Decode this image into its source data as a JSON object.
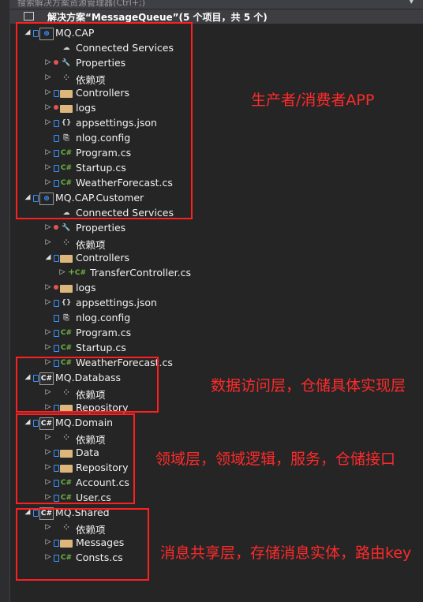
{
  "search": {
    "placeholder": "搜索解决方案资源管理器(Ctrl+;)"
  },
  "solution": {
    "label": "解决方案“MessageQueue”(5 个项目，共 5 个)"
  },
  "tree": [
    {
      "label": "MQ.CAP",
      "icon": "project-icon",
      "arrow": "expanded",
      "lock": true,
      "indent": 0
    },
    {
      "label": "Connected Services",
      "icon": "cloud-icon",
      "arrow": "none",
      "lock": false,
      "indent": 1
    },
    {
      "label": "Properties",
      "icon": "properties-icon",
      "arrow": "collapsed",
      "lock": false,
      "red": true,
      "indent": 1
    },
    {
      "label": "依赖项",
      "icon": "dependencies-icon",
      "arrow": "collapsed",
      "lock": false,
      "indent": 1
    },
    {
      "label": "Controllers",
      "icon": "folder-icon",
      "arrow": "collapsed",
      "lock": true,
      "indent": 1
    },
    {
      "label": "logs",
      "icon": "folder-icon",
      "arrow": "collapsed",
      "lock": false,
      "red": true,
      "indent": 1
    },
    {
      "label": "appsettings.json",
      "icon": "json-icon",
      "arrow": "collapsed",
      "lock": true,
      "indent": 1
    },
    {
      "label": "nlog.config",
      "icon": "config-icon",
      "arrow": "none",
      "lock": true,
      "indent": 1
    },
    {
      "label": "Program.cs",
      "icon": "csharp-icon",
      "arrow": "collapsed",
      "lock": true,
      "indent": 1
    },
    {
      "label": "Startup.cs",
      "icon": "csharp-icon",
      "arrow": "collapsed",
      "lock": true,
      "indent": 1
    },
    {
      "label": "WeatherForecast.cs",
      "icon": "csharp-icon",
      "arrow": "collapsed",
      "lock": true,
      "indent": 1
    },
    {
      "label": "MQ.CAP.Customer",
      "icon": "project-icon",
      "arrow": "expanded",
      "lock": true,
      "indent": 0
    },
    {
      "label": "Connected Services",
      "icon": "cloud-icon",
      "arrow": "none",
      "lock": false,
      "indent": 1
    },
    {
      "label": "Properties",
      "icon": "properties-icon",
      "arrow": "collapsed",
      "lock": false,
      "red": true,
      "indent": 1
    },
    {
      "label": "依赖项",
      "icon": "dependencies-icon",
      "arrow": "collapsed",
      "lock": false,
      "indent": 1
    },
    {
      "label": "Controllers",
      "icon": "folder-icon",
      "arrow": "expanded",
      "lock": true,
      "indent": 1
    },
    {
      "label": "TransferController.cs",
      "icon": "csharp-icon",
      "arrow": "collapsed",
      "lock": false,
      "plus": true,
      "indent": 2
    },
    {
      "label": "logs",
      "icon": "folder-icon",
      "arrow": "collapsed",
      "lock": false,
      "red": true,
      "indent": 1
    },
    {
      "label": "appsettings.json",
      "icon": "json-icon",
      "arrow": "collapsed",
      "lock": true,
      "indent": 1
    },
    {
      "label": "nlog.config",
      "icon": "config-icon",
      "arrow": "none",
      "lock": true,
      "indent": 1
    },
    {
      "label": "Program.cs",
      "icon": "csharp-icon",
      "arrow": "collapsed",
      "lock": true,
      "indent": 1
    },
    {
      "label": "Startup.cs",
      "icon": "csharp-icon",
      "arrow": "collapsed",
      "lock": true,
      "indent": 1
    },
    {
      "label": "WeatherForecast.cs",
      "icon": "csharp-icon",
      "arrow": "collapsed",
      "lock": true,
      "indent": 1
    },
    {
      "label": "MQ.Databass",
      "icon": "csproj-icon",
      "arrow": "expanded",
      "lock": true,
      "indent": 0
    },
    {
      "label": "依赖项",
      "icon": "dependencies-icon",
      "arrow": "collapsed",
      "lock": false,
      "indent": 1
    },
    {
      "label": "Repository",
      "icon": "folder-icon",
      "arrow": "collapsed",
      "lock": true,
      "indent": 1
    },
    {
      "label": "MQ.Domain",
      "icon": "csproj-icon",
      "arrow": "expanded",
      "lock": true,
      "indent": 0
    },
    {
      "label": "依赖项",
      "icon": "dependencies-icon",
      "arrow": "collapsed",
      "lock": false,
      "indent": 1
    },
    {
      "label": "Data",
      "icon": "folder-icon",
      "arrow": "collapsed",
      "lock": true,
      "indent": 1
    },
    {
      "label": "Repository",
      "icon": "folder-icon",
      "arrow": "collapsed",
      "lock": true,
      "indent": 1
    },
    {
      "label": "Account.cs",
      "icon": "csharp-icon",
      "arrow": "collapsed",
      "lock": true,
      "indent": 1
    },
    {
      "label": "User.cs",
      "icon": "csharp-icon",
      "arrow": "collapsed",
      "lock": true,
      "indent": 1
    },
    {
      "label": "MQ.Shared",
      "icon": "csproj-icon",
      "arrow": "expanded",
      "lock": true,
      "indent": 0
    },
    {
      "label": "依赖项",
      "icon": "dependencies-icon",
      "arrow": "collapsed",
      "lock": false,
      "indent": 1
    },
    {
      "label": "Messages",
      "icon": "folder-icon",
      "arrow": "collapsed",
      "lock": true,
      "indent": 1
    },
    {
      "label": "Consts.cs",
      "icon": "csharp-icon",
      "arrow": "collapsed",
      "lock": true,
      "indent": 1
    }
  ],
  "annotations": {
    "producer_consumer": "生产者/消费者APP",
    "data_access": "数据访问层，仓储具体实现层",
    "domain": "领域层，领域逻辑，服务，仓储接口",
    "shared": "消息共享层，存储消息实体，路由key"
  },
  "colors": {
    "background": "#252526",
    "annotation": "#ff1f1f",
    "csharp": "#6db33f",
    "folder": "#dcb67a",
    "lock": "#3794ff"
  }
}
